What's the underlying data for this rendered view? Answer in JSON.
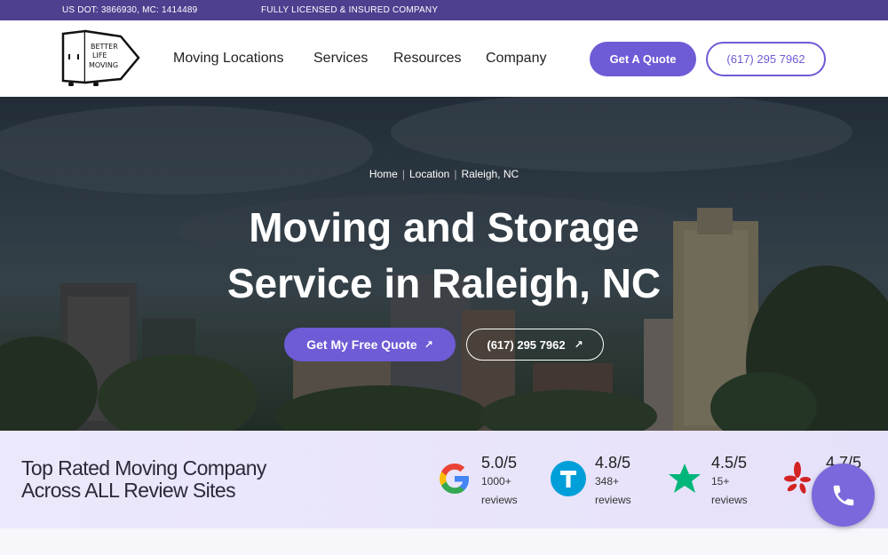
{
  "topbar": {
    "dot_mc": "US DOT: 3866930, MC: 1414489",
    "licensed": "FULLY LICENSED & INSURED COMPANY"
  },
  "header": {
    "logo_text": [
      "BETTER",
      "LIFE",
      "MOVING"
    ],
    "nav": [
      "Moving Locations",
      "Services",
      "Resources",
      "Company"
    ],
    "quote_button": "Get A Quote",
    "phone_button": "(617) 295 7962"
  },
  "hero": {
    "breadcrumb": [
      "Home",
      "Location",
      "Raleigh, NC"
    ],
    "title_line1": "Moving and Storage",
    "title_line2": "Service in Raleigh, NC",
    "cta_primary": "Get My Free Quote",
    "cta_secondary": "(617) 295 7962"
  },
  "reviews": {
    "title_line1": "Top Rated Moving Company",
    "title_line2": "Across ALL Review Sites",
    "items": [
      {
        "icon": "google-icon",
        "score": "5.0/5",
        "count": "1000+",
        "label": "reviews"
      },
      {
        "icon": "thumbtack-icon",
        "score": "4.8/5",
        "count": "348+",
        "label": "reviews"
      },
      {
        "icon": "trustpilot-star-icon",
        "score": "4.5/5",
        "count": "15+",
        "label": "reviews"
      },
      {
        "icon": "yelp-icon",
        "score": "4.7/5",
        "count": "",
        "label": ""
      }
    ]
  },
  "colors": {
    "brand": "#6e5bd6",
    "topbar": "#4f3f8f",
    "review_strip": "#ece8fb"
  },
  "call_button": {
    "icon": "phone-icon"
  }
}
